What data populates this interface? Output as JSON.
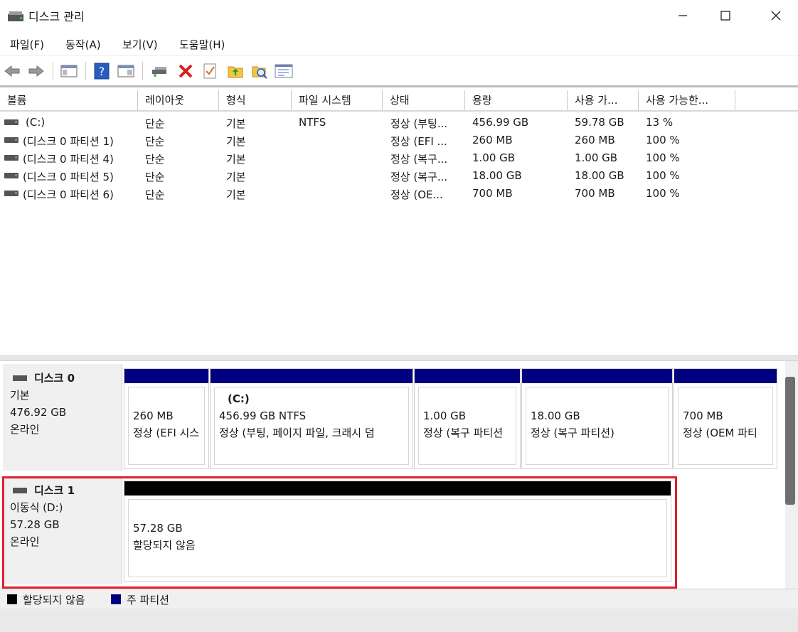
{
  "window": {
    "title": "디스크 관리"
  },
  "menu": [
    "파일(F)",
    "동작(A)",
    "보기(V)",
    "도움말(H)"
  ],
  "toolbar_icons": [
    "back-icon",
    "forward-icon",
    "console-tree-icon",
    "help-icon",
    "action-pane-icon",
    "connect-drive-icon",
    "delete-icon",
    "check-icon",
    "folder-up-icon",
    "search-icon",
    "properties-icon"
  ],
  "columns": [
    "볼륨",
    "레이아웃",
    "형식",
    "파일 시스템",
    "상태",
    "용량",
    "사용 가...",
    "사용 가능한..."
  ],
  "volumes": [
    {
      "name": "(C:)",
      "layout": "단순",
      "type": "기본",
      "fs": "NTFS",
      "status": "정상 (부팅...",
      "capacity": "456.99 GB",
      "free": "59.78 GB",
      "pct": "13 %"
    },
    {
      "name": "(디스크 0 파티션 1)",
      "layout": "단순",
      "type": "기본",
      "fs": "",
      "status": "정상 (EFI ...",
      "capacity": "260 MB",
      "free": "260 MB",
      "pct": "100 %"
    },
    {
      "name": "(디스크 0 파티션 4)",
      "layout": "단순",
      "type": "기본",
      "fs": "",
      "status": "정상 (복구...",
      "capacity": "1.00 GB",
      "free": "1.00 GB",
      "pct": "100 %"
    },
    {
      "name": "(디스크 0 파티션 5)",
      "layout": "단순",
      "type": "기본",
      "fs": "",
      "status": "정상 (복구...",
      "capacity": "18.00 GB",
      "free": "18.00 GB",
      "pct": "100 %"
    },
    {
      "name": "(디스크 0 파티션 6)",
      "layout": "단순",
      "type": "기본",
      "fs": "",
      "status": "정상 (OE...",
      "capacity": "700 MB",
      "free": "700 MB",
      "pct": "100 %"
    }
  ],
  "disk0": {
    "name": "디스크 0",
    "type": "기본",
    "size": "476.92 GB",
    "state": "온라인",
    "partitions": [
      {
        "label": "",
        "size": "260 MB",
        "status": "정상 (EFI 시스"
      },
      {
        "label": "(C:)",
        "size": "456.99 GB NTFS",
        "status": "정상 (부팅, 페이지 파일, 크래시 덤"
      },
      {
        "label": "",
        "size": "1.00 GB",
        "status": "정상 (복구 파티션"
      },
      {
        "label": "",
        "size": "18.00 GB",
        "status": "정상 (복구 파티션)"
      },
      {
        "label": "",
        "size": "700 MB",
        "status": "정상 (OEM 파티"
      }
    ]
  },
  "disk1": {
    "name": "디스크 1",
    "type": "이동식 (D:)",
    "size": "57.28 GB",
    "state": "온라인",
    "partitions": [
      {
        "size": "57.28 GB",
        "status": "할당되지 않음"
      }
    ]
  },
  "legend": [
    {
      "label": "할당되지 않음",
      "color": "#000000"
    },
    {
      "label": "주 파티션",
      "color": "#00007f"
    }
  ],
  "colors": {
    "primary_partition": "#000080",
    "unallocated": "#000000",
    "highlight": "#e0202c"
  }
}
